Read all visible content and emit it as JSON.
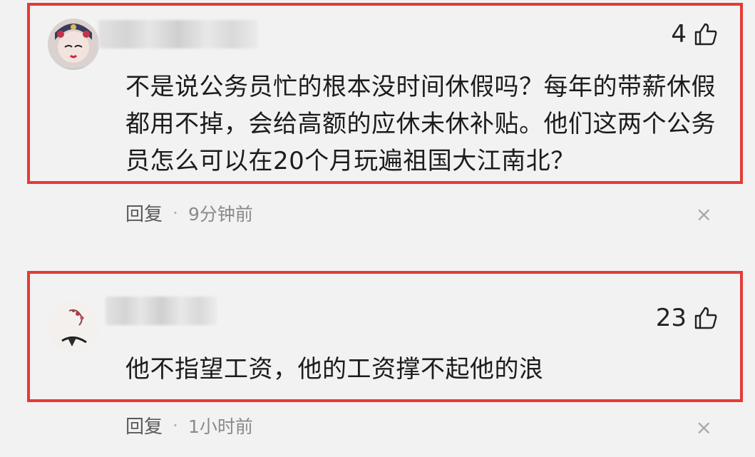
{
  "comments": [
    {
      "likes": "4",
      "text": "不是说公务员忙的根本没时间休假吗？每年的带薪休假都用不掉，会给高额的应休未休补贴。他们这两个公务员怎么可以在20个月玩遍祖国大江南北？",
      "reply_label": "回复",
      "separator": "·",
      "time": "9分钟前",
      "close_glyph": "×"
    },
    {
      "likes": "23",
      "text": "他不指望工资，他的工资撑不起他的浪",
      "reply_label": "回复",
      "separator": "·",
      "time": "1小时前",
      "close_glyph": "×"
    }
  ],
  "colors": {
    "highlight": "#e43a36",
    "background": "#f2f2f2",
    "meta_text": "#8a8a8a"
  }
}
